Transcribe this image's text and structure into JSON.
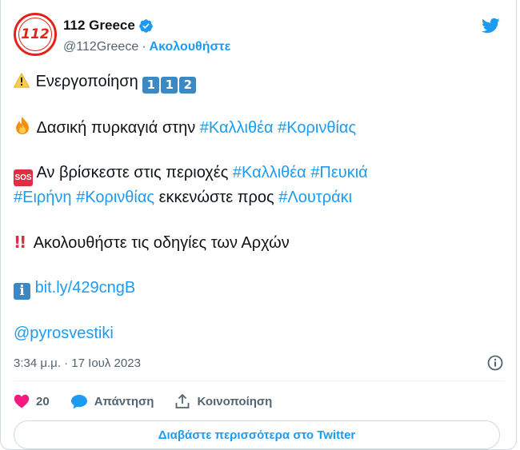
{
  "account": {
    "display_name": "112 Greece",
    "handle": "@112Greece",
    "separator": "·",
    "follow_label": "Ακολουθήστε",
    "avatar_text": "112"
  },
  "tweet": {
    "line1": {
      "text": "Ενεργοποίηση",
      "keycaps": [
        "1",
        "1",
        "2"
      ]
    },
    "line2": {
      "text": "Δασική πυρκαγιά στην",
      "tags": [
        "#Καλλιθέα",
        "#Κορινθίας"
      ]
    },
    "line3": {
      "sos_label": "SOS",
      "text": "Αν βρίσκεστε στις περιοχές",
      "tags": [
        "#Καλλιθέα",
        "#Πευκιά"
      ]
    },
    "line4": {
      "tag_a": "#Ειρήνη",
      "tag_b": "#Κορινθίας",
      "text": "εκκενώστε προς",
      "tag_c": "#Λουτράκι"
    },
    "line5": {
      "bang": "!!",
      "text": "Ακολουθήστε τις οδηγίες των Αρχών"
    },
    "line6": {
      "info_label": "i",
      "link": "bit.ly/429cngB"
    },
    "line7": {
      "mention": "@pyrosvestiki"
    }
  },
  "meta": {
    "timestamp": "3:34 μ.μ. · 17 Ιουλ 2023"
  },
  "actions": {
    "like_count": "20",
    "reply_label": "Απάντηση",
    "share_label": "Κοινοποίηση"
  },
  "footer": {
    "read_more_label": "Διαβάστε περισσότερα στο Twitter"
  },
  "colors": {
    "accent": "#1d9bf0",
    "like": "#f91880",
    "brand_red": "#e2231a"
  },
  "icons": [
    "avatar-112-logo",
    "verified-badge-icon",
    "twitter-bird-icon",
    "warning-icon",
    "fire-icon",
    "sos-icon",
    "double-exclamation-icon",
    "info-icon",
    "info-circle-icon",
    "heart-icon",
    "reply-bubble-icon",
    "share-icon"
  ]
}
